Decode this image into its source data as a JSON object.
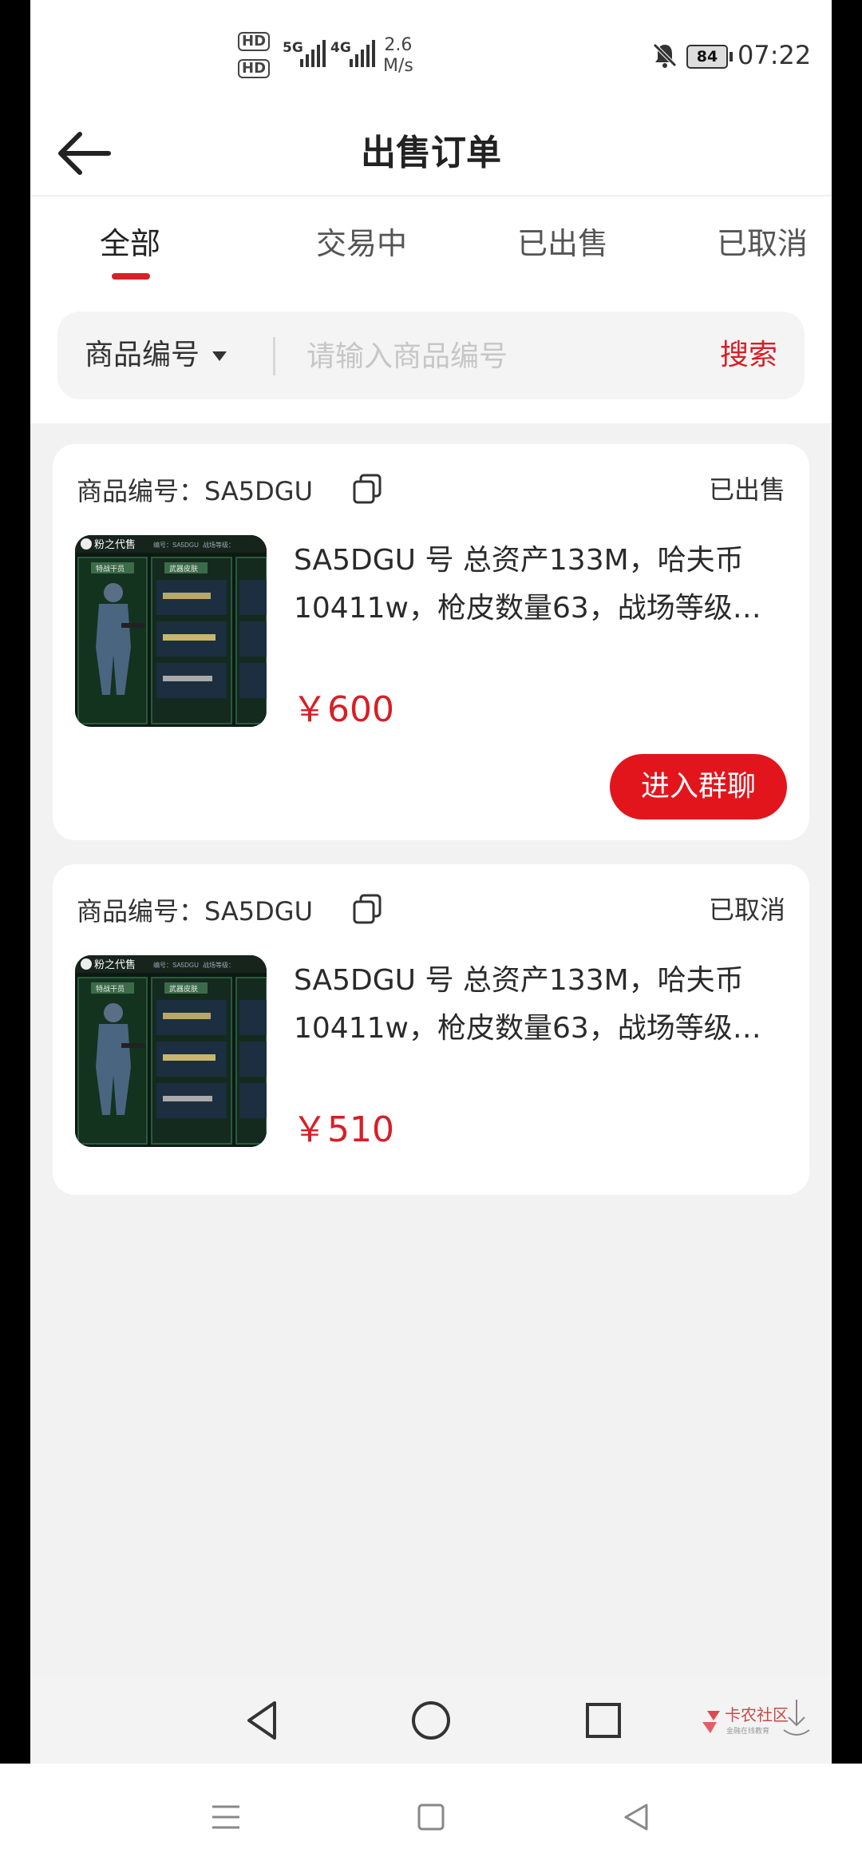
{
  "status_bar": {
    "hd1": "HD",
    "hd2": "HD",
    "sig1": "5G",
    "sig2": "4G",
    "speed_value": "2.6",
    "speed_unit": "M/s",
    "battery": "84",
    "time": "07:22"
  },
  "header": {
    "title": "出售订单"
  },
  "tabs": [
    {
      "label": "全部",
      "active": true
    },
    {
      "label": "交易中",
      "active": false
    },
    {
      "label": "已出售",
      "active": false
    },
    {
      "label": "已取消",
      "active": false
    }
  ],
  "search": {
    "filter_label": "商品编号",
    "placeholder": "请输入商品编号",
    "button_label": "搜索"
  },
  "orders": [
    {
      "code": "商品编号：SA5DGU",
      "status": "已出售",
      "title": "SA5DGU 号 总资产133M，哈夫币10411w，枪皮数量63，战场等级…",
      "price": "￥600",
      "action_label": "进入群聊"
    },
    {
      "code": "商品编号：SA5DGU",
      "status": "已取消",
      "title": "SA5DGU 号 总资产133M，哈夫币10411w，枪皮数量63，战场等级…",
      "price": "￥510"
    }
  ],
  "thumbnail": {
    "brand": "粉之代售",
    "tag1": "编号：SA5DGU",
    "tag2": "战场等级：",
    "panel1": "特战干员",
    "panel2": "武器皮肤"
  },
  "watermark": {
    "line1": "卡农社区",
    "line2": "金融在线教育"
  },
  "colors": {
    "accent": "#d71f26",
    "button": "#e3151c",
    "background": "#f2f2f2"
  }
}
